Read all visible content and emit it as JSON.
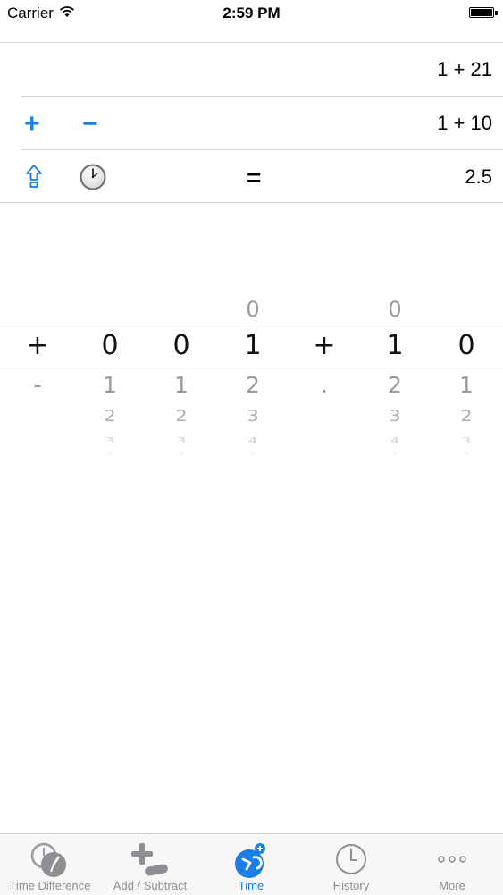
{
  "status_bar": {
    "carrier": "Carrier",
    "time": "2:59 PM"
  },
  "display": {
    "line1": "1 + 21",
    "line2": "1 + 10",
    "result": "2.5",
    "plus_label": "+",
    "minus_label": "−",
    "equals_label": "=",
    "accent_color": "#1a7ee6"
  },
  "picker": {
    "columns": [
      {
        "up": "",
        "selected": "+",
        "below": [
          "-",
          "",
          "",
          ""
        ]
      },
      {
        "up": "",
        "selected": "0",
        "below": [
          "1",
          "2",
          "3",
          "4"
        ]
      },
      {
        "up": "",
        "selected": "0",
        "below": [
          "1",
          "2",
          "3",
          "4"
        ]
      },
      {
        "up": "0",
        "selected": "1",
        "below": [
          "2",
          "3",
          "4",
          "5"
        ]
      },
      {
        "up": "",
        "selected": "+",
        "below": [
          ".",
          "",
          "",
          ""
        ]
      },
      {
        "up": "0",
        "selected": "1",
        "below": [
          "2",
          "3",
          "4",
          "5"
        ]
      },
      {
        "up": "",
        "selected": "0",
        "below": [
          "1",
          "2",
          "3",
          "4"
        ]
      }
    ]
  },
  "tabs": [
    {
      "label": "Time Difference",
      "icon": "time-difference-icon",
      "active": false
    },
    {
      "label": "Add / Subtract",
      "icon": "add-subtract-icon",
      "active": false
    },
    {
      "label": "Time",
      "icon": "time-icon",
      "active": true
    },
    {
      "label": "History",
      "icon": "history-clock-icon",
      "active": false
    },
    {
      "label": "More",
      "icon": "more-dots-icon",
      "active": false
    }
  ]
}
